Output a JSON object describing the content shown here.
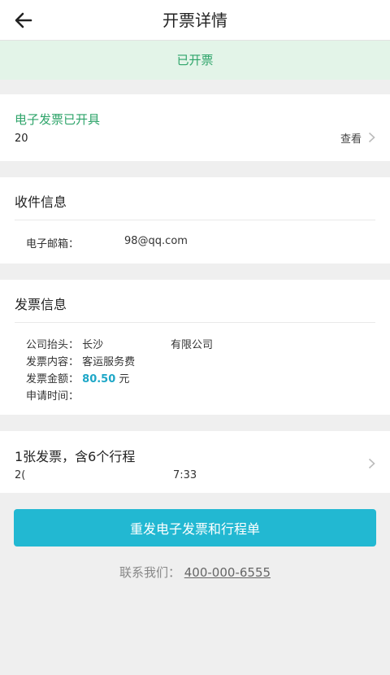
{
  "header": {
    "title": "开票详情",
    "back_icon": "arrow-left-icon"
  },
  "status": {
    "label": "已开票",
    "color": "#2ea46a"
  },
  "invoice_card": {
    "title": "电子发票已开具",
    "number": "20",
    "view_label": "查看",
    "chevron_icon": "chevron-right-icon"
  },
  "recipient": {
    "title": "收件信息",
    "email_label": "电子邮箱：",
    "email_value": "98@qq.com"
  },
  "invoice_info": {
    "title": "发票信息",
    "company_label": "公司抬头：",
    "company_value_a": "长沙",
    "company_value_b": "有限公司",
    "content_label": "发票内容：",
    "content_value": "客运服务费",
    "amount_label": "发票金额：",
    "amount_value": "80.50",
    "amount_unit": "元",
    "time_label": "申请时间：",
    "time_value": ""
  },
  "trip": {
    "title": "1张发票，含6个行程",
    "date": "2(",
    "time": "7:33",
    "chevron_icon": "chevron-right-icon"
  },
  "action": {
    "button_label": "重发电子发票和行程单",
    "color": "#22b8d2"
  },
  "contact": {
    "label": "联系我们：",
    "phone": "400-000-6555"
  }
}
